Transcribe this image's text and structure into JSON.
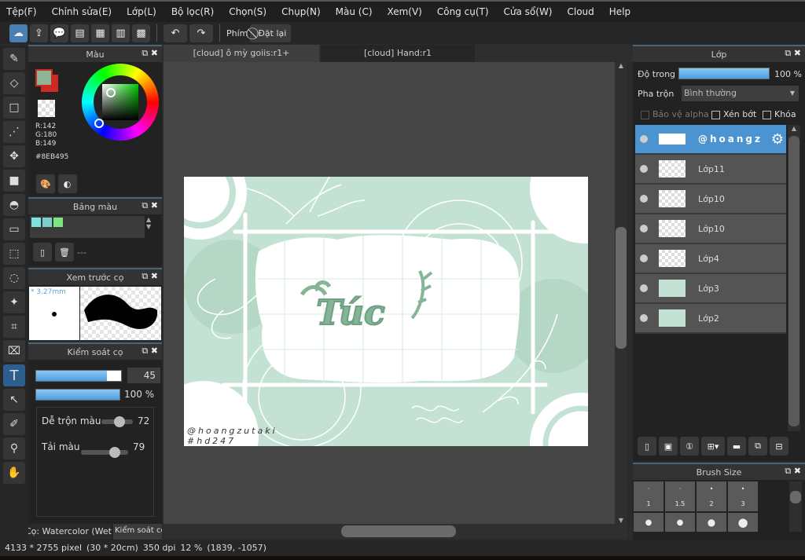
{
  "menu": [
    "Tệp(F)",
    "Chỉnh sửa(E)",
    "Lớp(L)",
    "Bộ lọc(R)",
    "Chọn(S)",
    "Chụp(N)",
    "Màu (C)",
    "Xem(V)",
    "Công cụ(T)",
    "Cửa sổ(W)",
    "Cloud",
    "Help"
  ],
  "toolbar": {
    "shortcut_label": "Phím",
    "reset_label": "Đặt lại"
  },
  "color_panel": {
    "title": "Màu",
    "r": "R:142",
    "g": "G:180",
    "b": "B:149",
    "hex": "#8EB495",
    "fg_color": "#8EB495",
    "bg_color": "#cc2a22"
  },
  "palette_panel": {
    "title": "Bảng màu",
    "swatches": [
      "#7de3e3",
      "#7bd0cf",
      "#7fe67f"
    ],
    "name": "---"
  },
  "brush_preview": {
    "title": "Xem trước cọ",
    "size": "* 3.27mm"
  },
  "brush_control": {
    "title": "Kiểm soát cọ",
    "size_value": "45",
    "size_fraction": 0.45,
    "opacity": "100 %",
    "blend_label": "Dễ trộn màu",
    "blend_value": "72",
    "reload_label": "Tải màu",
    "reload_value": "79",
    "tab_brush": "Cọ: Watercolor (Wet",
    "tab_control": "Kiểm soát cọ"
  },
  "tabs": [
    "[cloud] ô mỳ goiis:r1+",
    "[cloud] Hand:r1"
  ],
  "artwork": {
    "title": "Túc",
    "watermark1": "@hoangzutaki",
    "watermark2": "#hd247"
  },
  "layers_panel": {
    "title": "Lớp",
    "opacity_label": "Độ trong",
    "opacity_value": "100 %",
    "blend_label": "Pha trộn",
    "blend_value": "Bình thường",
    "protect_alpha": "Bảo vệ alpha",
    "clipping": "Xén bớt",
    "lock": "Khóa",
    "layers": [
      {
        "name": "@hoangz",
        "selected": true
      },
      {
        "name": "Lớp11"
      },
      {
        "name": "Lớp10"
      },
      {
        "name": "Lớp10"
      },
      {
        "name": "Lớp4"
      },
      {
        "name": "Lớp3"
      },
      {
        "name": "Lớp2"
      }
    ]
  },
  "brush_size": {
    "title": "Brush Size",
    "sizes": [
      "1",
      "1.5",
      "2",
      "3"
    ]
  },
  "status": {
    "dimensions": "4133 * 2755 pixel",
    "physical": "(30 * 20cm)",
    "dpi": "350 dpi",
    "zoom": "12 %",
    "coords": "(1839, -1057)"
  }
}
